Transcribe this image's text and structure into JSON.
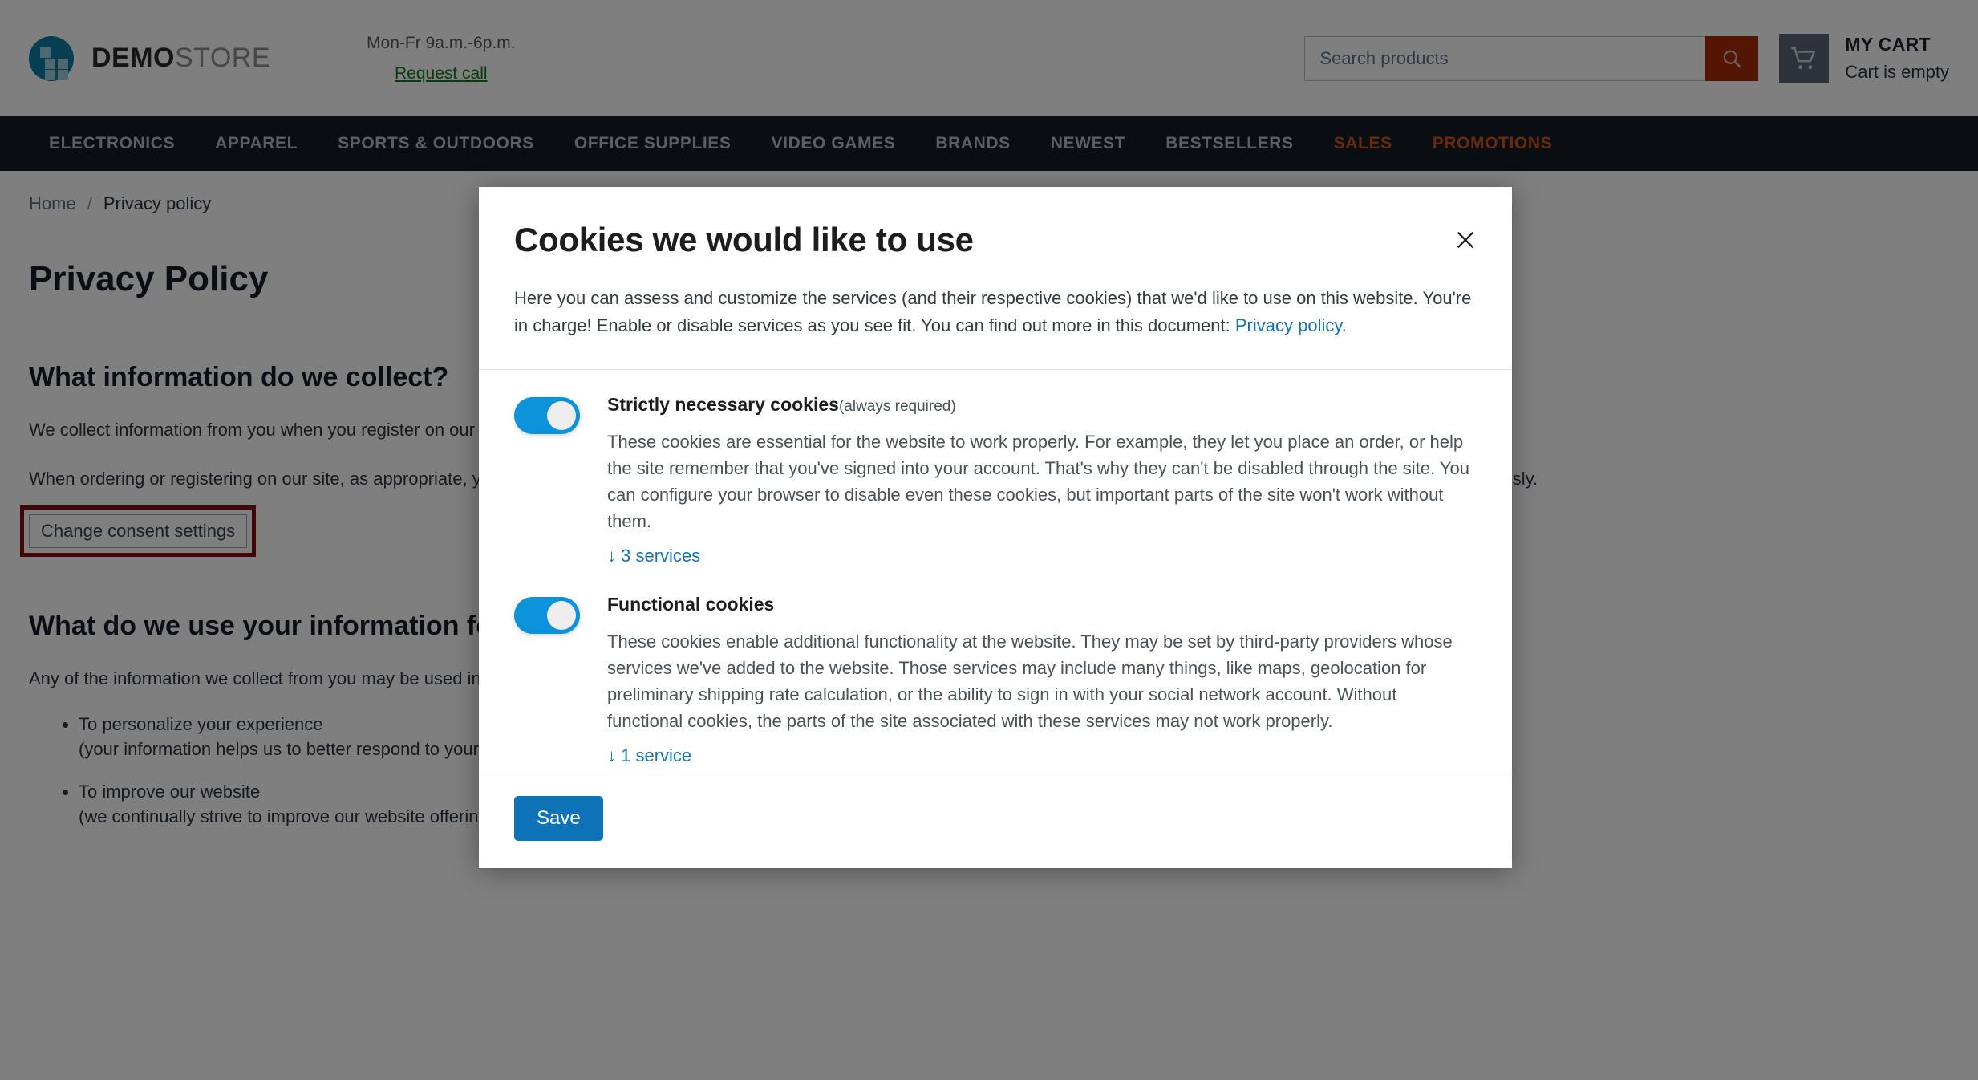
{
  "colors": {
    "brand_teal": "#0b7fa3",
    "nav_bg": "#141b24",
    "nav_accent": "#d4540d",
    "search_btn": "#a72a09",
    "toggle_on": "#0d93db",
    "link_blue": "#1273b8",
    "save_blue": "#0f73b8",
    "highlight_red": "#8b0b10",
    "request_call_green": "#0e7a1d"
  },
  "header": {
    "logo_icon": "squares-logo-icon",
    "brand_bold": "DEMO",
    "brand_light": "STORE",
    "hours": "Mon-Fr 9a.m.-6p.m.",
    "request_call": "Request call",
    "search": {
      "placeholder": "Search products",
      "value": "",
      "button_icon": "search-icon"
    },
    "cart": {
      "icon": "shopping-cart-icon",
      "title": "MY CART",
      "status": "Cart is empty"
    }
  },
  "nav": {
    "items": [
      {
        "label": "ELECTRONICS",
        "accent": false
      },
      {
        "label": "APPAREL",
        "accent": false
      },
      {
        "label": "SPORTS & OUTDOORS",
        "accent": false
      },
      {
        "label": "OFFICE SUPPLIES",
        "accent": false
      },
      {
        "label": "VIDEO GAMES",
        "accent": false
      },
      {
        "label": "BRANDS",
        "accent": false
      },
      {
        "label": "NEWEST",
        "accent": false
      },
      {
        "label": "BESTSELLERS",
        "accent": false
      },
      {
        "label": "SALES",
        "accent": true
      },
      {
        "label": "PROMOTIONS",
        "accent": true
      }
    ]
  },
  "breadcrumb": {
    "home": "Home",
    "separator": "/",
    "current": "Privacy policy"
  },
  "page": {
    "title": "Privacy Policy",
    "section1_heading": "What information do we collect?",
    "section1_para1": "We collect information from you when you register on our site or place an order.",
    "section1_para2": "When ordering or registering on our site, as appropriate, you may be asked to enter your: name, e-mail address, mailing address or phone number. You may, however, visit our site anonymously.",
    "consent_button": "Change consent settings",
    "section2_heading": "What do we use your information for?",
    "section2_para": "Any of the information we collect from you may be used in one of the following ways:",
    "uses": [
      {
        "line1": "To personalize your experience",
        "line2": "(your information helps us to better respond to your individual needs)"
      },
      {
        "line1": "To improve our website",
        "line2": "(we continually strive to improve our website offerings based on the information and feedback we receive from you)"
      }
    ]
  },
  "modal": {
    "title": "Cookies we would like to use",
    "close_icon": "close-icon",
    "intro_before_link": "Here you can assess and customize the services (and their respective cookies) that we'd like to use on this website. You're in charge! Enable or disable services as you see fit. You can find out more in this document: ",
    "intro_link": "Privacy policy",
    "intro_after_link": ".",
    "services": [
      {
        "title": "Strictly necessary cookies",
        "note": "(always required)",
        "toggle_state": "on",
        "description": "These cookies are essential for the website to work properly. For example, they let you place an order, or help the site remember that you've signed into your account. That's why they can't be disabled through the site. You can configure your browser to disable even these cookies, but important parts of the site won't work without them.",
        "expand_link": "↓ 3 services"
      },
      {
        "title": "Functional cookies",
        "note": "",
        "toggle_state": "on",
        "description": "These cookies enable additional functionality at the website. They may be set by third-party providers whose services we've added to the website. Those services may include many things, like maps, geolocation for preliminary shipping rate calculation, or the ability to sign in with your social network account. Without functional cookies, the parts of the site associated with these services may not work properly.",
        "expand_link": "↓ 1 service"
      }
    ],
    "save_label": "Save"
  }
}
